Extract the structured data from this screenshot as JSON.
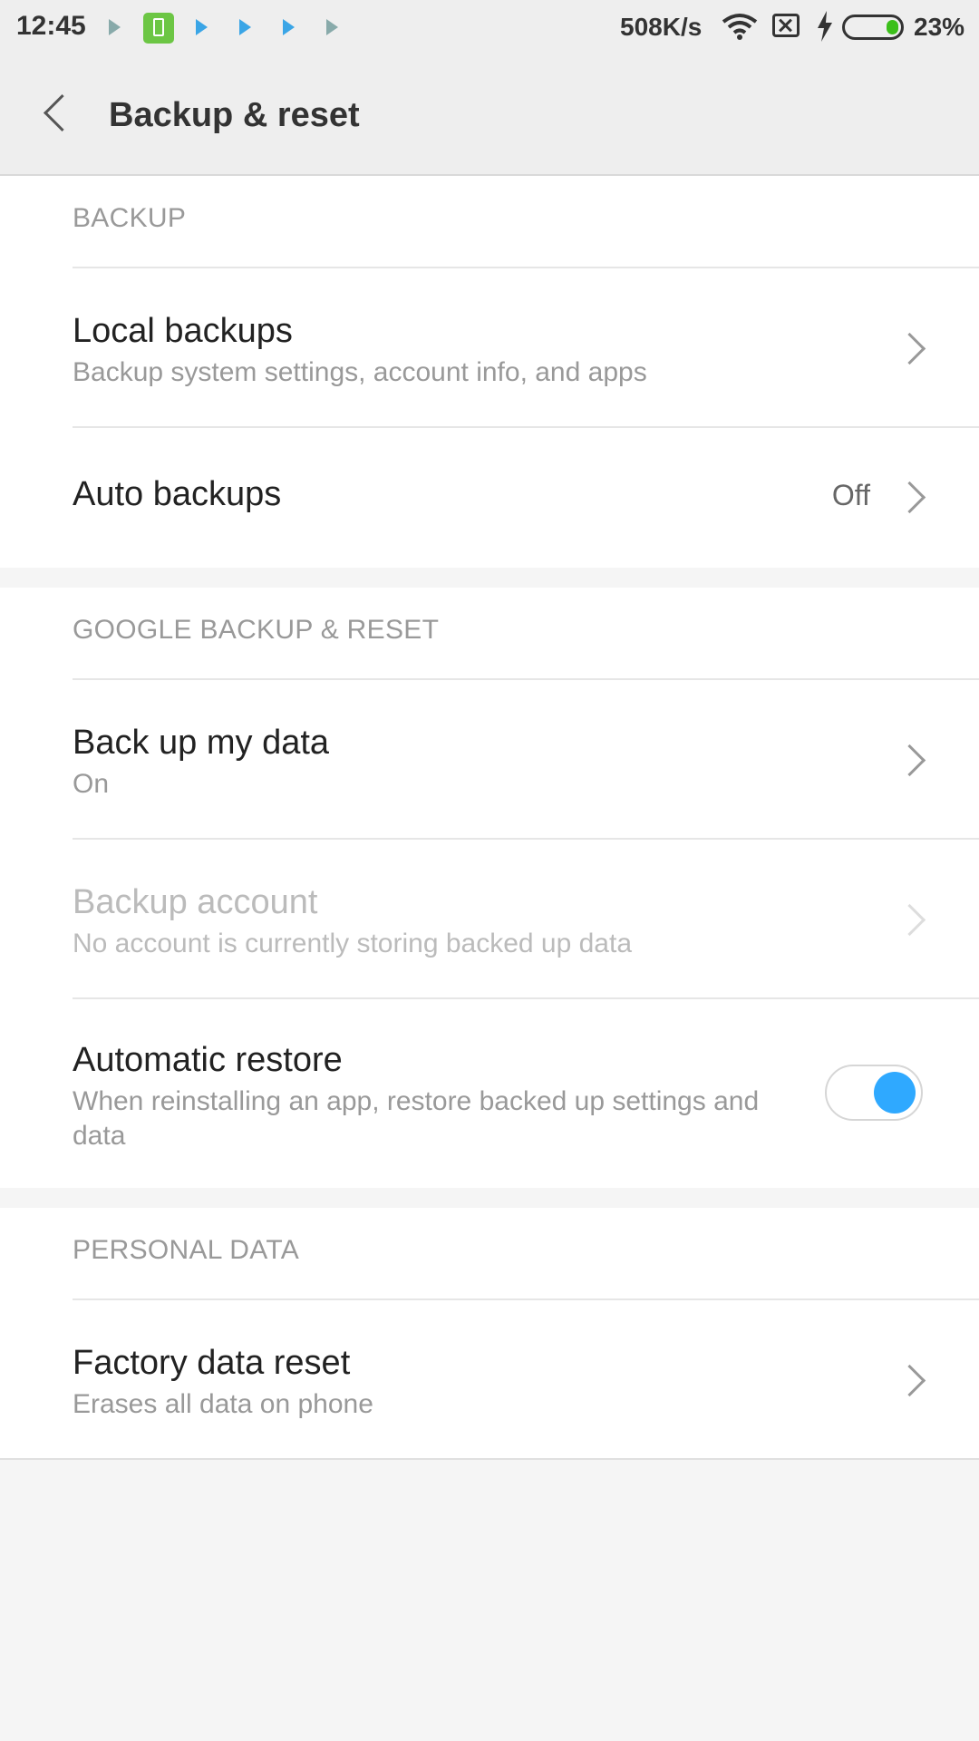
{
  "status_bar": {
    "time": "12:45",
    "net_speed": "508K/s",
    "battery_percent": "23%",
    "battery_level": 0.23,
    "icons": [
      "play-store-icon",
      "battery-app-icon",
      "play-store-icon",
      "play-store-icon",
      "play-store-icon",
      "play-store-icon",
      "wifi-icon",
      "no-sim-icon",
      "charging-icon",
      "battery-icon"
    ]
  },
  "header": {
    "title": "Backup & reset",
    "back_icon": "chevron-left-icon"
  },
  "sections": {
    "backup": {
      "label": "BACKUP",
      "local_backups": {
        "title": "Local backups",
        "subtitle": "Backup system settings, account info, and apps"
      },
      "auto_backups": {
        "title": "Auto backups",
        "value": "Off"
      }
    },
    "google": {
      "label": "GOOGLE BACKUP & RESET",
      "back_up_my_data": {
        "title": "Back up my data",
        "subtitle": "On"
      },
      "backup_account": {
        "title": "Backup account",
        "subtitle": "No account is currently storing backed up data",
        "disabled": true
      },
      "automatic_restore": {
        "title": "Automatic restore",
        "subtitle": "When reinstalling an app, restore backed up settings and data",
        "enabled": true
      }
    },
    "personal": {
      "label": "PERSONAL DATA",
      "factory_reset": {
        "title": "Factory data reset",
        "subtitle": "Erases all data on phone"
      }
    }
  },
  "colors": {
    "accent": "#2fa9ff",
    "battery_green": "#3bbf1a",
    "background": "#f5f5f5"
  }
}
